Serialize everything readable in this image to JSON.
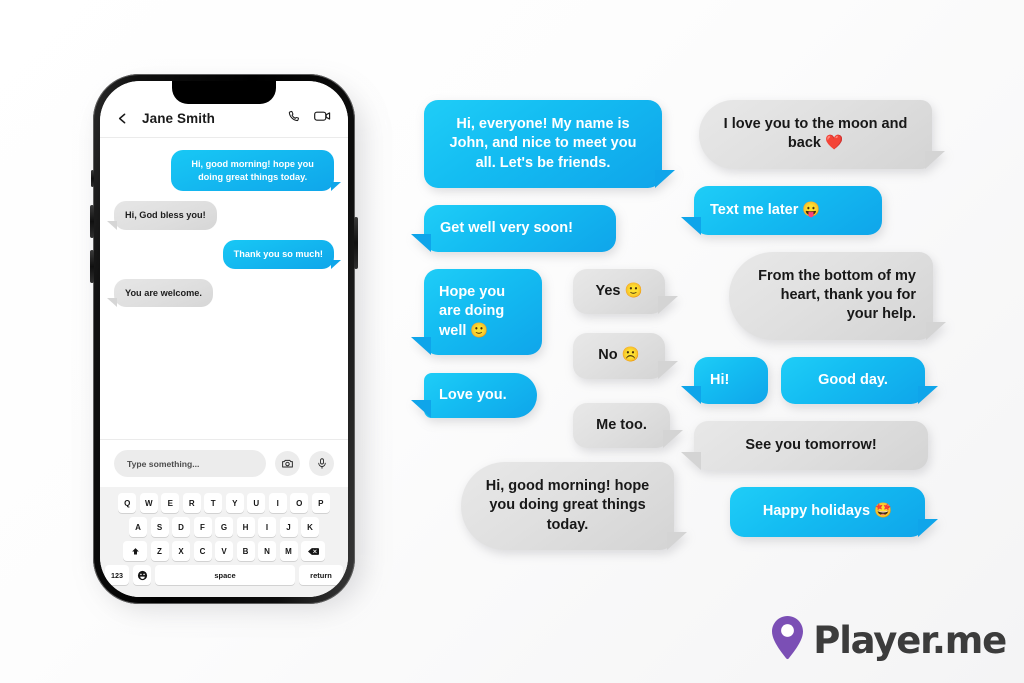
{
  "colors": {
    "blue_light": "#1fcdf7",
    "blue_dark": "#0fa5ea",
    "grey_light": "#e8e8e8",
    "grey_dark": "#d4d4d4",
    "logo_purple": "#7b4fb5",
    "logo_text": "#3c3c3c",
    "page_bg": "#ffffff"
  },
  "phone": {
    "header": {
      "back_icon": "chevron-left-icon",
      "contact_name": "Jane Smith",
      "call_icon": "phone-icon",
      "video_icon": "video-camera-icon"
    },
    "messages": [
      {
        "side": "me",
        "text": "Hi, good morning! hope you doing great things today."
      },
      {
        "side": "them",
        "text": "Hi, God bless you!"
      },
      {
        "side": "me",
        "text": "Thank you so much!"
      },
      {
        "side": "them",
        "text": "You are welcome."
      }
    ],
    "input_bar": {
      "placeholder": "Type something...",
      "camera_icon": "camera-icon",
      "mic_icon": "microphone-icon"
    },
    "keyboard": {
      "row1": [
        "Q",
        "W",
        "E",
        "R",
        "T",
        "Y",
        "U",
        "I",
        "O",
        "P"
      ],
      "row2": [
        "A",
        "S",
        "D",
        "F",
        "G",
        "H",
        "I",
        "J",
        "K"
      ],
      "row3_shift": "shift-icon",
      "row3": [
        "Z",
        "X",
        "C",
        "V",
        "B",
        "N",
        "M"
      ],
      "row3_backspace": "backspace-icon",
      "numbers_key": "123",
      "emoji_key": "emoji-icon",
      "space_key": "space",
      "return_key": "return"
    }
  },
  "middle_column": [
    {
      "style": "blue",
      "align": "center",
      "tail": "bottom-right",
      "text": "Hi, everyone! My name is John, and nice to meet you all. Let's be friends."
    },
    {
      "style": "blue",
      "align": "left",
      "tail": "bottom-left",
      "text": "Get well very soon!"
    },
    {
      "style": "blue",
      "align": "left",
      "tail": "bottom-left",
      "text": "Hope you are doing well 🙂"
    },
    {
      "style": "grey",
      "align": "center",
      "tail": "bottom-right",
      "text": "Yes 🙂"
    },
    {
      "style": "grey",
      "align": "center",
      "tail": "bottom-right",
      "text": "No ☹️"
    },
    {
      "style": "blue",
      "align": "left",
      "tail": "bottom-left",
      "text": "Love you."
    },
    {
      "style": "grey",
      "align": "center",
      "tail": "bottom-right",
      "text": "Me too."
    },
    {
      "style": "grey",
      "align": "center",
      "tail": "bottom-right",
      "text": "Hi, good morning! hope you doing great things today."
    }
  ],
  "right_column": [
    {
      "style": "grey",
      "align": "center",
      "tail": "bottom-right",
      "text": "I love you to the moon and back ❤️"
    },
    {
      "style": "blue",
      "align": "left",
      "tail": "bottom-left",
      "text": "Text me later 😛"
    },
    {
      "style": "grey",
      "align": "right",
      "tail": "bottom-right",
      "text": "From the bottom of my heart, thank you for your help."
    },
    {
      "style": "blue",
      "align": "left",
      "tail": "bottom-left",
      "text": "Hi!"
    },
    {
      "style": "blue",
      "align": "center",
      "tail": "bottom-right",
      "text": "Good day."
    },
    {
      "style": "grey",
      "align": "center",
      "tail": "bottom-left",
      "text": "See you tomorrow!"
    },
    {
      "style": "blue",
      "align": "center",
      "tail": "bottom-right",
      "text": "Happy holidays 🤩"
    }
  ],
  "logo": {
    "mark": "location-pin-icon",
    "text": "Player.me"
  }
}
